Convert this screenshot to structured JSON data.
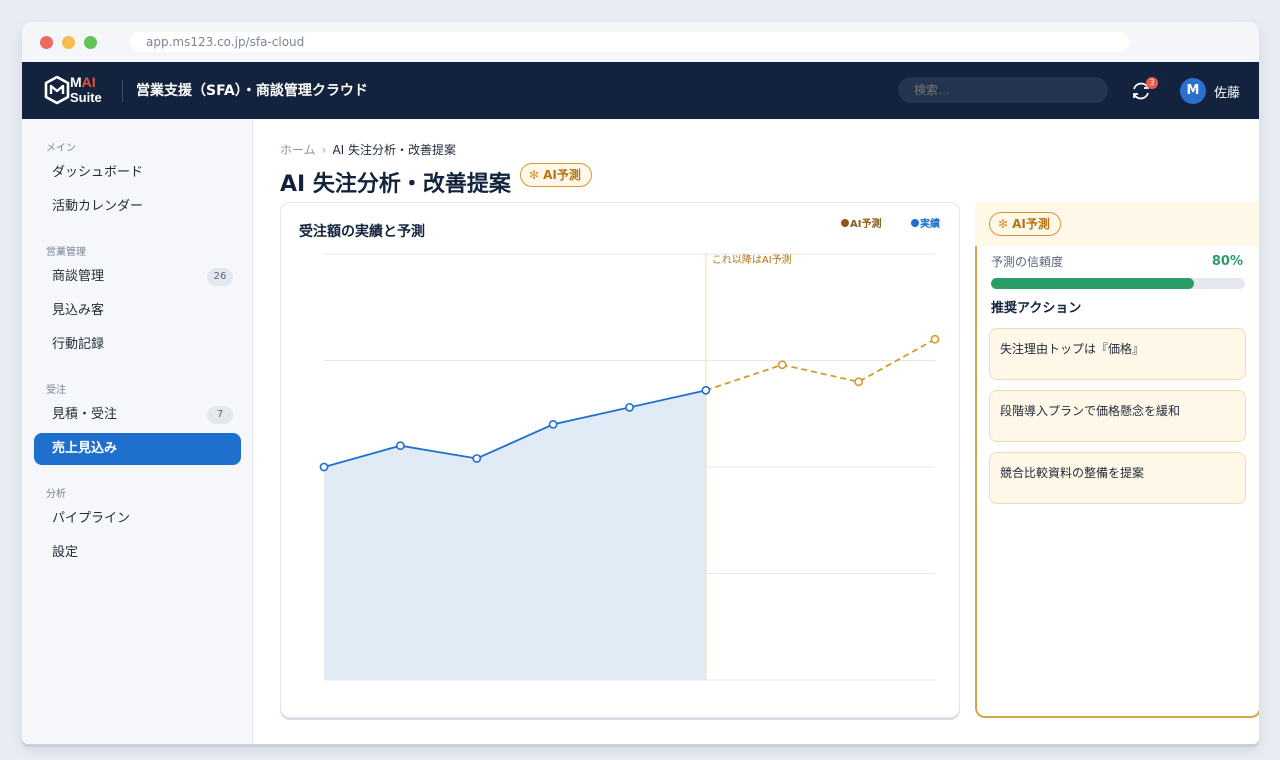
{
  "browser": {
    "url": "app.ms123.co.jp/sfa-cloud"
  },
  "header": {
    "logo_m": "M",
    "logo_ai": "AI",
    "logo_suite": "Suite",
    "app_title": "営業支援（SFA）・商談管理クラウド",
    "search_placeholder": "検索…",
    "notification_count": "3",
    "avatar_initial": "M",
    "user_name": "佐藤"
  },
  "sidebar": {
    "sections": [
      {
        "label": "メイン",
        "items": [
          {
            "label": "ダッシュボード"
          },
          {
            "label": "活動カレンダー"
          }
        ]
      },
      {
        "label": "営業管理",
        "items": [
          {
            "label": "商談管理",
            "count": "26"
          },
          {
            "label": "見込み客"
          },
          {
            "label": "行動記録"
          }
        ]
      },
      {
        "label": "受注",
        "items": [
          {
            "label": "見積・受注",
            "count": "7"
          },
          {
            "label": "売上見込み",
            "active": true
          }
        ]
      },
      {
        "label": "分析",
        "items": [
          {
            "label": "パイプライン"
          },
          {
            "label": "設定"
          }
        ]
      }
    ]
  },
  "breadcrumb": {
    "home": "ホーム",
    "separator": "›",
    "current": "AI 失注分析・改善提案"
  },
  "page": {
    "title": "AI 失注分析・改善提案",
    "ai_tag": "AI予測"
  },
  "chart_card": {
    "title": "受注額の実績と予測",
    "legend_ai": "AI予測",
    "legend_actual": "実績",
    "forecast_note": "これ以降はAI予測"
  },
  "chart_data": {
    "type": "line",
    "title": "受注額の実績と予測",
    "xlabel": "",
    "ylabel": "",
    "ylim": [
      0,
      100
    ],
    "grid": true,
    "legend_position": "top-right",
    "x": [
      1,
      2,
      3,
      4,
      5,
      6,
      7,
      8,
      9
    ],
    "series": [
      {
        "name": "実績",
        "color": "#1f6fcd",
        "style": "solid",
        "area": true,
        "x": [
          1,
          2,
          3,
          4,
          5,
          6
        ],
        "values": [
          50,
          55,
          52,
          60,
          64,
          68
        ]
      },
      {
        "name": "AI予測",
        "color": "#d59a2c",
        "style": "dashed",
        "x": [
          6,
          7,
          8,
          9
        ],
        "values": [
          68,
          74,
          70,
          80
        ]
      }
    ],
    "forecast_start_x": 6
  },
  "ai_panel": {
    "tag": "AI予測",
    "confidence_label": "予測の信頼度",
    "confidence_value": "80%",
    "confidence": 0.8,
    "actions_title": "推奨アクション",
    "actions": [
      "失注理由トップは『価格』",
      "段階導入プランで価格懸念を緩和",
      "競合比較資料の整備を提案"
    ]
  }
}
